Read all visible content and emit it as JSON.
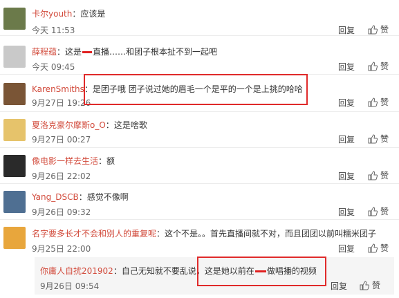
{
  "comments": [
    {
      "name": "卡尔youth",
      "sep": "：",
      "text": "应该是",
      "time": "今天 11:53",
      "reply": "回复",
      "like": "赞",
      "avatar_color": "#6b7a4a"
    },
    {
      "name": "薛程蕴",
      "sep": "：",
      "text_a": "这是",
      "text_b": "直播……和团子根本扯不到一起吧",
      "time": "今天 09:45",
      "reply": "回复",
      "like": "赞",
      "avatar_color": "#c9c9c9"
    },
    {
      "name": "KarenSmiths",
      "sep": "：",
      "text": "是团子哦 团子说过她的眉毛一个是平的一个是上挑的哈哈",
      "time": "9月27日 19:26",
      "reply": "回复",
      "like": "赞",
      "avatar_color": "#7a5536"
    },
    {
      "name": "夏洛克豪尔摩斯o_O",
      "sep": "：",
      "text": "这是啥歌",
      "time": "9月27日 00:27",
      "reply": "回复",
      "like": "赞",
      "avatar_color": "#e6c36b"
    },
    {
      "name": "像电影一样去生活",
      "sep": "：",
      "text": "额",
      "time": "9月26日 22:02",
      "reply": "回复",
      "like": "赞",
      "avatar_color": "#2a2a2a"
    },
    {
      "name": "Yang_DSCB",
      "sep": "：",
      "text": "感觉不像啊",
      "time": "9月26日 09:32",
      "reply": "回复",
      "like": "赞",
      "avatar_color": "#4f6f92"
    },
    {
      "name": "名字要多长才不会和别人的重复呢",
      "sep": "：",
      "text": "这个不是。。首先直播间就不对，而且团团以前叫糯米团子",
      "time": "9月25日 22:00",
      "reply": "回复",
      "like": "赞",
      "avatar_color": "#e8a63c"
    }
  ],
  "sub_reply": {
    "name": "你庸人自扰201902",
    "sep": "：",
    "text_a": "自己无知就不要乱说，这是她以前在",
    "text_b": "做唱播的视频",
    "time": "9月26日 09:54",
    "reply": "回复",
    "like": "赞"
  }
}
